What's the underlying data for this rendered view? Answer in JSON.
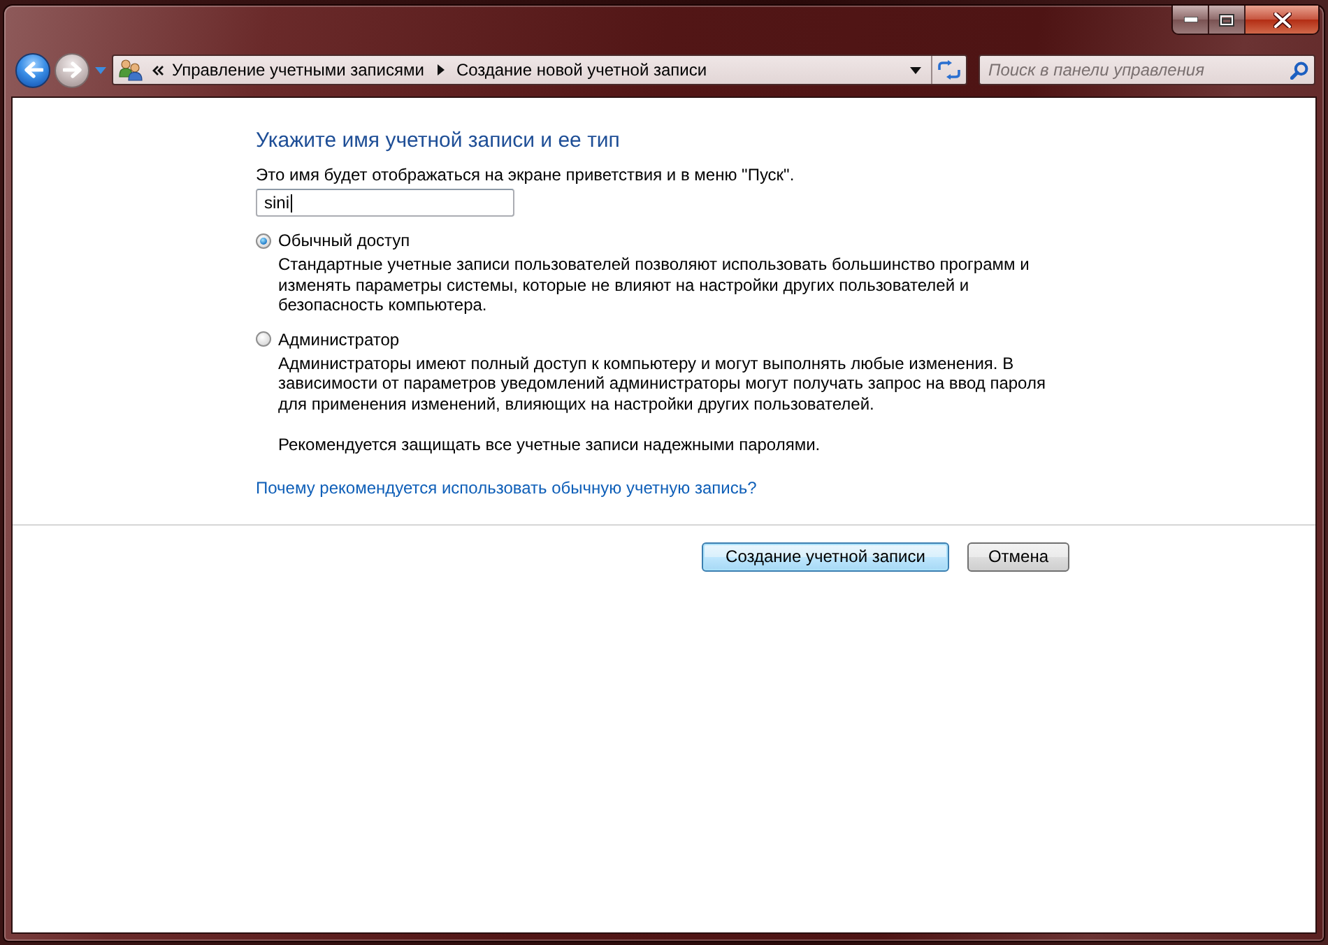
{
  "navigation": {
    "back": {
      "disabled": false
    },
    "forward": {
      "disabled": true
    }
  },
  "address_bar": {
    "breadcrumbs": [
      "Управление учетными записями",
      "Создание новой учетной записи"
    ]
  },
  "search": {
    "placeholder": "Поиск в панели управления"
  },
  "form": {
    "heading": "Укажите имя учетной записи и ее тип",
    "name_label": "Это имя будет отображаться на экране приветствия и в меню \"Пуск\".",
    "name_field": {
      "value": "sini"
    },
    "account_types": [
      {
        "label": "Обычный доступ",
        "description": "Стандартные учетные записи пользователей позволяют использовать большинство программ и изменять параметры системы, которые не влияют на настройки других пользователей и безопасность компьютера.",
        "selected": true
      },
      {
        "label": "Администратор",
        "description": "Администраторы имеют полный доступ к компьютеру и могут выполнять любые изменения. В зависимости от параметров уведомлений администраторы могут получать запрос на ввод пароля для применения изменений, влияющих на настройки других пользователей.",
        "selected": false
      }
    ],
    "note": "Рекомендуется защищать все учетные записи надежными паролями.",
    "help_link": "Почему рекомендуется использовать обычную учетную запись?"
  },
  "buttons": [
    {
      "label": "Создание учетной записи",
      "default": true
    },
    {
      "label": "Отмена",
      "default": false
    }
  ]
}
